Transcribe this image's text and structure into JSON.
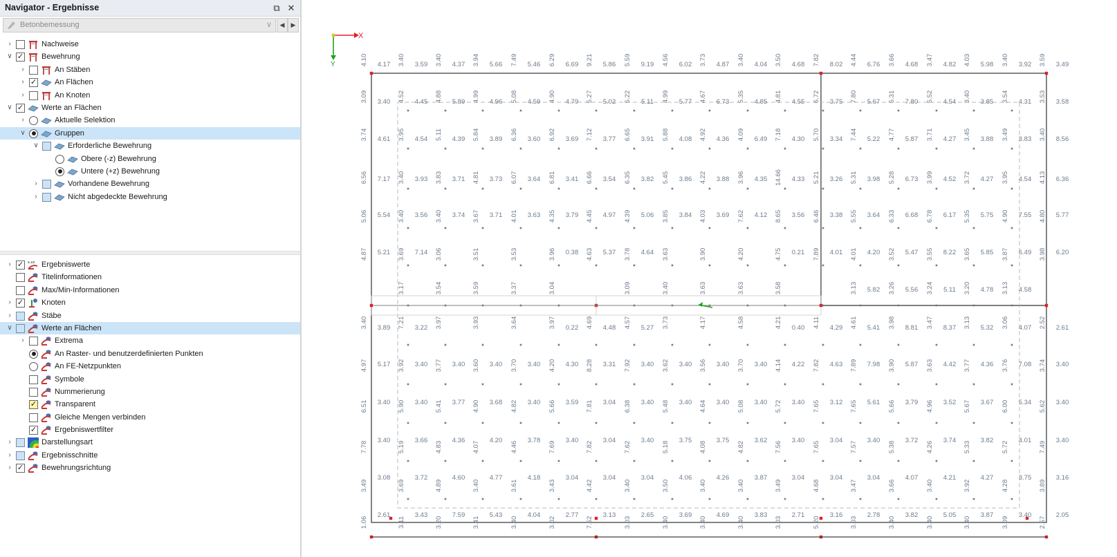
{
  "window": {
    "title": "Navigator - Ergebnisse",
    "pin_icon": "pin-icon",
    "close_icon": "close-icon"
  },
  "module_select": {
    "value": "Betonbemessung",
    "icon": "concrete-design-icon"
  },
  "tree_top": [
    {
      "label": "Nachweise",
      "level": 0,
      "expander": "collapsed",
      "control": "checkbox",
      "state": "unchecked",
      "icon": "member-icon"
    },
    {
      "label": "Bewehrung",
      "level": 0,
      "expander": "expanded",
      "control": "checkbox",
      "state": "checked",
      "icon": "member-icon"
    },
    {
      "label": "An Stäben",
      "level": 1,
      "expander": "collapsed",
      "control": "checkbox",
      "state": "unchecked",
      "icon": "member-icon"
    },
    {
      "label": "An Flächen",
      "level": 1,
      "expander": "collapsed",
      "control": "checkbox",
      "state": "checked",
      "icon": "surface-icon"
    },
    {
      "label": "An Knoten",
      "level": 1,
      "expander": "collapsed",
      "control": "checkbox",
      "state": "unchecked",
      "icon": "member-icon"
    },
    {
      "label": "Werte an Flächen",
      "level": 0,
      "expander": "expanded",
      "control": "checkbox",
      "state": "checked",
      "icon": "surface-icon"
    },
    {
      "label": "Aktuelle Selektion",
      "level": 1,
      "expander": "collapsed",
      "control": "radio",
      "state": "off",
      "icon": "surface-icon"
    },
    {
      "label": "Gruppen",
      "level": 1,
      "expander": "expanded",
      "control": "radio",
      "state": "on",
      "icon": "surface-icon",
      "selected": true
    },
    {
      "label": "Erforderliche Bewehrung",
      "level": 2,
      "expander": "expanded",
      "control": "checkbox",
      "state": "partial",
      "icon": "surface-icon"
    },
    {
      "label": "Obere (-z) Bewehrung",
      "level": 3,
      "expander": "none",
      "control": "radio",
      "state": "off",
      "icon": "surface-icon"
    },
    {
      "label": "Untere (+z) Bewehrung",
      "level": 3,
      "expander": "none",
      "control": "radio",
      "state": "on",
      "icon": "surface-icon"
    },
    {
      "label": "Vorhandene Bewehrung",
      "level": 2,
      "expander": "collapsed",
      "control": "checkbox",
      "state": "partial",
      "icon": "surface-icon"
    },
    {
      "label": "Nicht abgedeckte Bewehrung",
      "level": 2,
      "expander": "collapsed",
      "control": "checkbox",
      "state": "partial",
      "icon": "surface-icon"
    }
  ],
  "tree_bottom": [
    {
      "label": "Ergebniswerte",
      "level": 0,
      "expander": "collapsed",
      "control": "checkbox",
      "state": "checked",
      "icon": "result-values-icon"
    },
    {
      "label": "Titelinformationen",
      "level": 0,
      "expander": "none",
      "control": "checkbox",
      "state": "unchecked",
      "icon": "display-icon"
    },
    {
      "label": "Max/Min-Informationen",
      "level": 0,
      "expander": "none",
      "control": "checkbox",
      "state": "unchecked",
      "icon": "display-icon"
    },
    {
      "label": "Knoten",
      "level": 0,
      "expander": "collapsed",
      "control": "checkbox",
      "state": "checked",
      "icon": "node-icon"
    },
    {
      "label": "Stäbe",
      "level": 0,
      "expander": "collapsed",
      "control": "checkbox",
      "state": "partial",
      "icon": "display-icon"
    },
    {
      "label": "Werte an Flächen",
      "level": 0,
      "expander": "expanded",
      "control": "checkbox",
      "state": "partial",
      "icon": "display-icon",
      "selected": true
    },
    {
      "label": "Extrema",
      "level": 1,
      "expander": "collapsed",
      "control": "checkbox",
      "state": "unchecked",
      "icon": "display-icon"
    },
    {
      "label": "An Raster- und benutzerdefinierten Punkten",
      "level": 1,
      "expander": "none",
      "control": "radio",
      "state": "on",
      "icon": "display-icon"
    },
    {
      "label": "An FE-Netzpunkten",
      "level": 1,
      "expander": "none",
      "control": "radio",
      "state": "off",
      "icon": "display-icon"
    },
    {
      "label": "Symbole",
      "level": 1,
      "expander": "none",
      "control": "checkbox",
      "state": "unchecked",
      "icon": "display-icon"
    },
    {
      "label": "Nummerierung",
      "level": 1,
      "expander": "none",
      "control": "checkbox",
      "state": "unchecked",
      "icon": "display-icon"
    },
    {
      "label": "Transparent",
      "level": 1,
      "expander": "none",
      "control": "checkbox",
      "state": "checked-yellow",
      "icon": "display-icon"
    },
    {
      "label": "Gleiche Mengen verbinden",
      "level": 1,
      "expander": "none",
      "control": "checkbox",
      "state": "unchecked",
      "icon": "display-icon"
    },
    {
      "label": "Ergebniswertfilter",
      "level": 1,
      "expander": "none",
      "control": "checkbox",
      "state": "checked",
      "icon": "display-icon"
    },
    {
      "label": "Darstellungsart",
      "level": 0,
      "expander": "collapsed",
      "control": "checkbox",
      "state": "partial",
      "icon": "color-scale-icon"
    },
    {
      "label": "Ergebnisschnitte",
      "level": 0,
      "expander": "collapsed",
      "control": "checkbox",
      "state": "partial",
      "icon": "display-icon"
    },
    {
      "label": "Bewehrungsrichtung",
      "level": 0,
      "expander": "collapsed",
      "control": "checkbox",
      "state": "checked",
      "icon": "display-icon"
    }
  ],
  "axes": {
    "x_label": "X",
    "y_label": "Y"
  },
  "grid_values": {
    "columns": 19,
    "rows": [
      {
        "v": [
          "4.10",
          "3.40",
          "3.40",
          "3.94",
          "7.49",
          "6.29",
          "9.21",
          "5.59",
          "4.56",
          "3.73",
          "3.40",
          "3.50",
          "7.82",
          "4.44",
          "3.66",
          "3.47",
          "4.03",
          "3.40",
          "3.59"
        ],
        "h": [
          "4.17",
          "3.59",
          "4.37",
          "5.66",
          "5.46",
          "6.69",
          "5.86",
          "9.19",
          "6.02",
          "4.87",
          "4.04",
          "4.68",
          "8.02",
          "6.76",
          "4.68",
          "4.82",
          "5.98",
          "3.92",
          "3.49"
        ]
      },
      {
        "v": [
          "3.09",
          "4.52",
          "4.88",
          "4.99",
          "5.08",
          "4.90",
          "5.27",
          "5.22",
          "4.99",
          "4.67",
          "5.35",
          "4.81",
          "6.72",
          "7.80",
          "5.31",
          "5.52",
          "3.40",
          "3.54",
          "3.53"
        ],
        "h": [
          "3.40",
          "4.45",
          "5.89",
          "4.96",
          "4.59",
          "4.79",
          "5.02",
          "5.11",
          "5.77",
          "6.73",
          "4.85",
          "4.55",
          "3.75",
          "5.67",
          "7.80",
          "4.54",
          "3.85",
          "4.31",
          "3.58"
        ]
      },
      {
        "v": [
          "3.74",
          "3.95",
          "5.11",
          "5.84",
          "6.36",
          "6.92",
          "7.12",
          "6.65",
          "5.88",
          "4.92",
          "4.09",
          "7.18",
          "5.70",
          "7.44",
          "4.77",
          "3.71",
          "3.45",
          "3.49",
          "3.40"
        ],
        "h": [
          "4.61",
          "4.54",
          "4.39",
          "3.89",
          "3.60",
          "3.69",
          "3.77",
          "3.91",
          "4.08",
          "4.36",
          "6.49",
          "4.30",
          "3.34",
          "5.22",
          "5.87",
          "4.27",
          "3.88",
          "3.83",
          "8.56"
        ]
      },
      {
        "v": [
          "6.56",
          "3.40",
          "3.83",
          "4.81",
          "6.07",
          "6.81",
          "6.66",
          "6.35",
          "5.45",
          "4.22",
          "3.96",
          "14.66",
          "5.21",
          "5.31",
          "5.28",
          "3.99",
          "3.72",
          "3.95",
          "4.13"
        ],
        "h": [
          "7.17",
          "3.93",
          "3.71",
          "3.73",
          "3.64",
          "3.41",
          "3.54",
          "3.82",
          "3.86",
          "3.88",
          "4.35",
          "4.33",
          "3.26",
          "3.98",
          "6.73",
          "4.52",
          "4.27",
          "4.54",
          "6.36"
        ]
      },
      {
        "v": [
          "5.06",
          "3.40",
          "3.40",
          "3.67",
          "4.01",
          "4.35",
          "4.45",
          "4.39",
          "3.85",
          "4.03",
          "7.62",
          "8.65",
          "6.46",
          "5.55",
          "6.33",
          "6.78",
          "5.35",
          "4.90",
          "4.80"
        ],
        "h": [
          "5.54",
          "3.56",
          "3.74",
          "3.71",
          "3.63",
          "3.79",
          "4.97",
          "5.06",
          "3.84",
          "3.69",
          "4.12",
          "3.56",
          "3.38",
          "3.64",
          "6.68",
          "6.17",
          "5.75",
          "7.55",
          "5.77"
        ]
      },
      {
        "v": [
          "4.87",
          "3.69",
          "3.06",
          "3.51",
          "3.53",
          "3.96",
          "4.63",
          "3.78",
          "3.63",
          "3.90",
          "4.20",
          "4.75",
          "7.89",
          "4.01",
          "3.52",
          "3.55",
          "3.65",
          "3.87",
          "3.98"
        ],
        "h": [
          "5.21",
          "7.14",
          "",
          "",
          "",
          "0.38",
          "5.37",
          "4.64",
          "",
          "",
          "",
          "0.21",
          "4.01",
          "4.20",
          "5.47",
          "8.22",
          "5.85",
          "6.49",
          "6.20"
        ]
      },
      {
        "v": [
          "",
          "3.17",
          "3.54",
          "3.59",
          "3.37",
          "3.04",
          "",
          "3.09",
          "3.40",
          "3.63",
          "3.63",
          "3.58",
          "",
          "3.13",
          "3.26",
          "3.24",
          "3.20",
          "3.13",
          ""
        ],
        "h": [
          "",
          "",
          "",
          "",
          "",
          "",
          "",
          "",
          "",
          "",
          "",
          "",
          "",
          "5.82",
          "5.56",
          "5.11",
          "4.78",
          "4.58",
          ""
        ]
      },
      {
        "v": [
          "3.40",
          "7.21",
          "3.97",
          "3.93",
          "3.64",
          "3.97",
          "4.69",
          "4.57",
          "3.73",
          "4.17",
          "4.58",
          "4.21",
          "4.11",
          "4.61",
          "3.98",
          "3.47",
          "3.13",
          "3.06",
          "2.52"
        ],
        "h": [
          "3.89",
          "3.22",
          "",
          "",
          "",
          "0.22",
          "4.48",
          "5.27",
          "",
          "",
          "",
          "0.40",
          "4.29",
          "5.41",
          "8.81",
          "8.37",
          "5.32",
          "4.07",
          "2.61"
        ]
      },
      {
        "v": [
          "4.97",
          "3.92",
          "3.77",
          "3.60",
          "3.70",
          "4.20",
          "8.28",
          "7.92",
          "3.62",
          "3.56",
          "3.70",
          "4.14",
          "7.82",
          "7.89",
          "3.90",
          "3.63",
          "3.77",
          "3.76",
          "3.74"
        ],
        "h": [
          "5.17",
          "3.40",
          "3.40",
          "3.40",
          "3.40",
          "4.30",
          "3.31",
          "3.40",
          "3.40",
          "3.40",
          "3.40",
          "4.22",
          "4.63",
          "7.98",
          "5.87",
          "4.42",
          "4.36",
          "7.08",
          "3.40"
        ]
      },
      {
        "v": [
          "6.51",
          "5.90",
          "5.41",
          "4.90",
          "4.82",
          "5.66",
          "7.81",
          "6.38",
          "5.48",
          "4.64",
          "5.08",
          "5.72",
          "7.65",
          "7.65",
          "5.66",
          "4.96",
          "5.67",
          "6.00",
          "5.62"
        ],
        "h": [
          "3.40",
          "3.40",
          "3.77",
          "3.68",
          "3.40",
          "3.59",
          "3.04",
          "3.40",
          "3.40",
          "3.40",
          "3.40",
          "3.40",
          "3.12",
          "5.61",
          "3.79",
          "3.52",
          "3.67",
          "5.34",
          "3.40"
        ]
      },
      {
        "v": [
          "7.78",
          "5.19",
          "4.83",
          "4.07",
          "4.46",
          "7.69",
          "7.82",
          "7.62",
          "5.18",
          "4.08",
          "4.82",
          "7.56",
          "7.65",
          "7.57",
          "5.38",
          "4.26",
          "5.33",
          "5.72",
          "7.49"
        ],
        "h": [
          "3.40",
          "3.66",
          "4.36",
          "4.20",
          "3.78",
          "3.40",
          "3.04",
          "3.40",
          "3.75",
          "3.75",
          "3.62",
          "3.40",
          "3.04",
          "3.40",
          "3.72",
          "3.74",
          "3.82",
          "4.01",
          "3.40"
        ]
      },
      {
        "v": [
          "3.49",
          "3.69",
          "4.89",
          "3.40",
          "3.61",
          "3.43",
          "4.42",
          "3.40",
          "3.50",
          "3.40",
          "3.40",
          "3.49",
          "4.68",
          "3.47",
          "3.66",
          "3.40",
          "3.92",
          "4.28",
          "3.89"
        ],
        "h": [
          "3.08",
          "3.72",
          "4.60",
          "4.77",
          "4.18",
          "3.04",
          "3.04",
          "3.04",
          "4.06",
          "4.26",
          "3.87",
          "3.04",
          "3.04",
          "3.04",
          "4.07",
          "4.21",
          "4.27",
          "3.75",
          "3.16"
        ]
      },
      {
        "v": [
          "1.06",
          "3.11",
          "3.20",
          "3.41",
          "3.40",
          "3.02",
          "7.52",
          "3.03",
          "3.40",
          "3.40",
          "3.40",
          "3.03",
          "5.20",
          "3.03",
          "3.40",
          "3.40",
          "3.40",
          "3.09",
          "2.57"
        ],
        "h": [
          "2.61",
          "3.43",
          "7.59",
          "5.43",
          "4.04",
          "2.77",
          "3.13",
          "2.65",
          "3.69",
          "4.69",
          "3.83",
          "2.71",
          "3.16",
          "2.78",
          "3.82",
          "5.05",
          "3.87",
          "3.40",
          "2.05"
        ]
      }
    ]
  },
  "colors": {
    "value_text": "#6b7a8c",
    "edge_line": "#404040",
    "node_red": "#e0202a",
    "axis_x": "#e0202a",
    "axis_y": "#1fa31f",
    "selection_bg": "#cce4f7"
  }
}
